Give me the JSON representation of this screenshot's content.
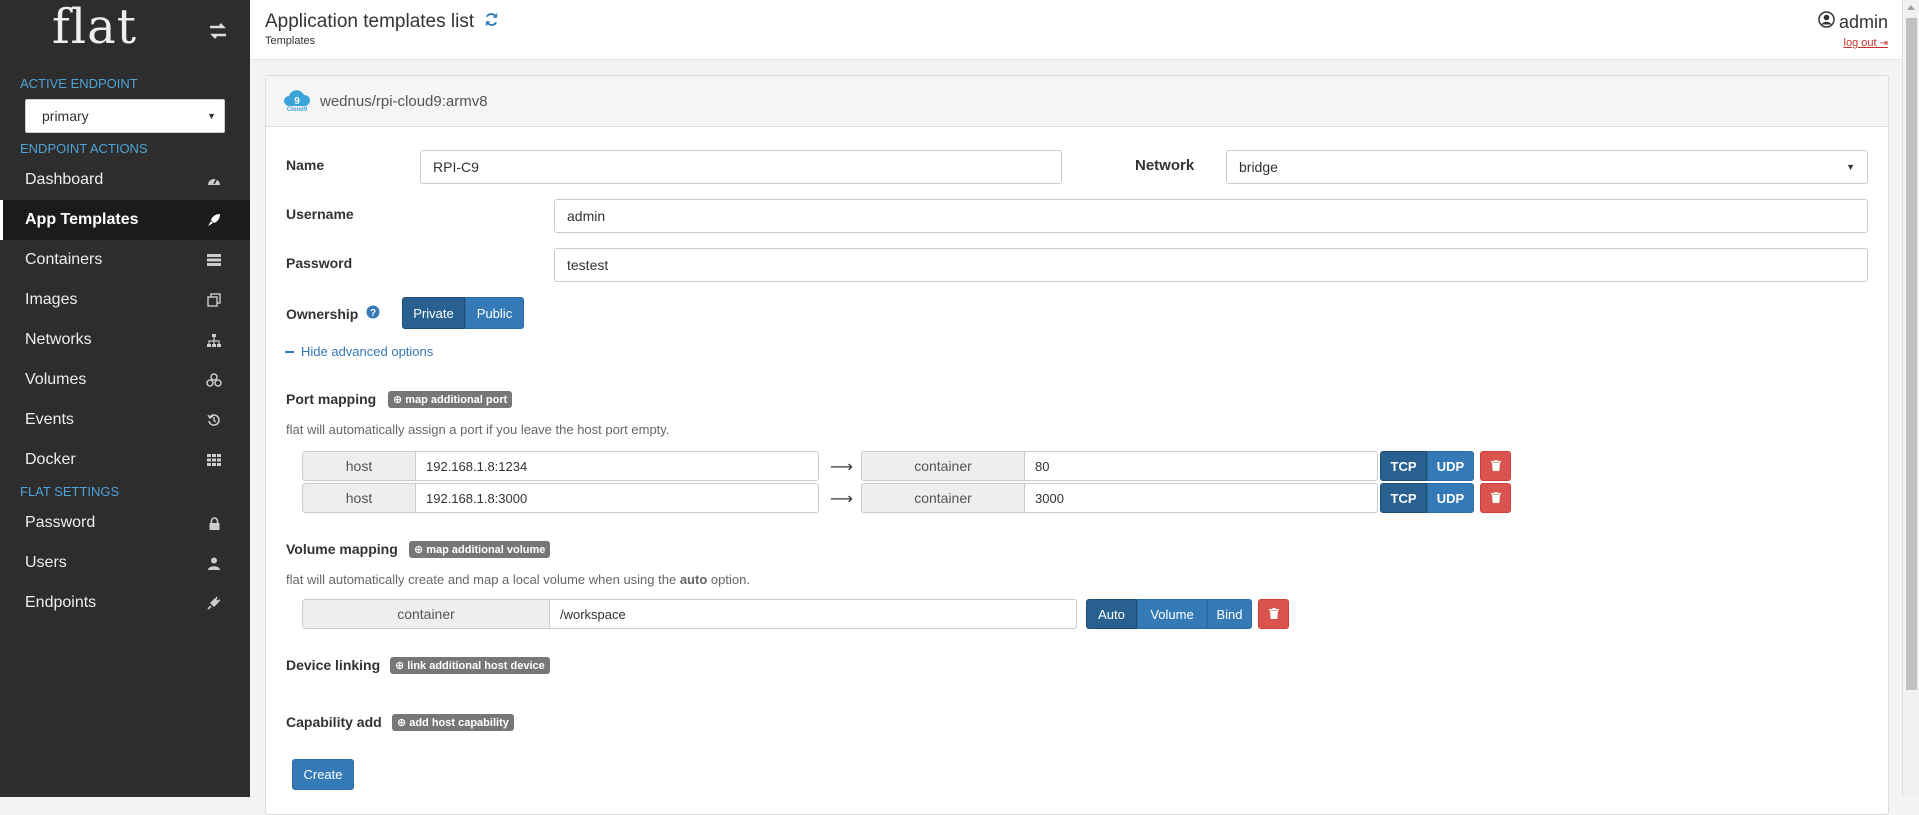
{
  "sidebar": {
    "logo": "flat",
    "active_endpoint_title": "ACTIVE ENDPOINT",
    "endpoint_value": "primary",
    "endpoint_actions_title": "ENDPOINT ACTIONS",
    "items": [
      {
        "label": "Dashboard",
        "icon": "dashboard-icon"
      },
      {
        "label": "App Templates",
        "icon": "rocket-icon"
      },
      {
        "label": "Containers",
        "icon": "server-icon"
      },
      {
        "label": "Images",
        "icon": "clone-icon"
      },
      {
        "label": "Networks",
        "icon": "sitemap-icon"
      },
      {
        "label": "Volumes",
        "icon": "cubes-icon"
      },
      {
        "label": "Events",
        "icon": "history-icon"
      },
      {
        "label": "Docker",
        "icon": "grid-icon"
      }
    ],
    "flat_settings_title": "FLAT SETTINGS",
    "settings_items": [
      {
        "label": "Password",
        "icon": "lock-icon"
      },
      {
        "label": "Users",
        "icon": "user-icon"
      },
      {
        "label": "Endpoints",
        "icon": "plug-icon"
      }
    ]
  },
  "header": {
    "title": "Application templates list",
    "breadcrumb": "Templates",
    "user": "admin",
    "logout": "log out"
  },
  "panel": {
    "template_name": "wednus/rpi-cloud9:armv8",
    "logo_text": "Cloud9",
    "name_label": "Name",
    "name_value": "RPI-C9",
    "network_label": "Network",
    "network_value": "bridge",
    "username_label": "Username",
    "username_value": "admin",
    "password_label": "Password",
    "password_value": "testest",
    "ownership_label": "Ownership",
    "ownership_private": "Private",
    "ownership_public": "Public",
    "advanced_toggle": "Hide advanced options",
    "port_mapping_label": "Port mapping",
    "port_mapping_add": "map additional port",
    "port_mapping_help": "flat will automatically assign a port if you leave the host port empty.",
    "ports": [
      {
        "host_label": "host",
        "host_value": "192.168.1.8:1234",
        "container_label": "container",
        "container_value": "80",
        "tcp": "TCP",
        "udp": "UDP"
      },
      {
        "host_label": "host",
        "host_value": "192.168.1.8:3000",
        "container_label": "container",
        "container_value": "3000",
        "tcp": "TCP",
        "udp": "UDP"
      }
    ],
    "volume_mapping_label": "Volume mapping",
    "volume_mapping_add": "map additional volume",
    "volume_help_pre": "flat will automatically create and map a local volume when using the",
    "volume_help_bold": "auto",
    "volume_help_post": "option.",
    "volume": {
      "container_label": "container",
      "container_value": "/workspace",
      "auto": "Auto",
      "volume": "Volume",
      "bind": "Bind"
    },
    "device_linking_label": "Device linking",
    "device_linking_add": "link additional host device",
    "capability_label": "Capability add",
    "capability_add": "add host capability",
    "create_button": "Create"
  },
  "colors": {
    "sidebar_bg": "#2d2d2d",
    "accent": "#337ab7",
    "accent_active": "#286090",
    "danger": "#d9534f",
    "section_title": "#4fa3d6"
  }
}
